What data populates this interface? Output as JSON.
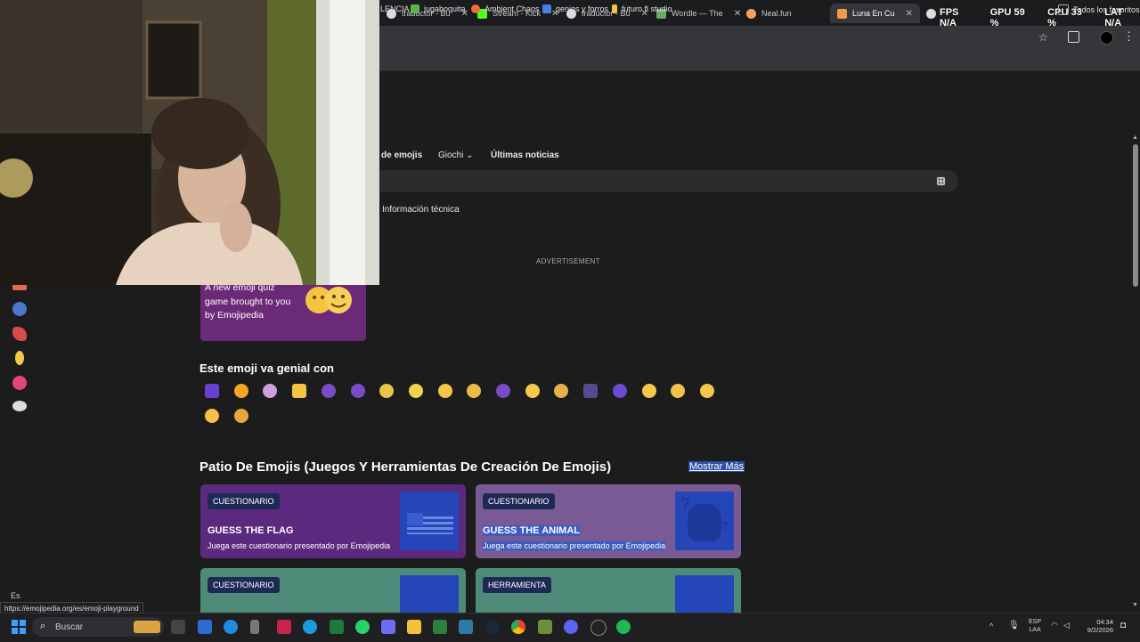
{
  "tabs": [
    {
      "label": "traductor - Bu",
      "color": "#4285f4"
    },
    {
      "label": "Stream - Kick",
      "color": "#53fc18"
    },
    {
      "label": "traductor - Bu",
      "color": "#4285f4"
    },
    {
      "label": "Wordle — The",
      "color": "#6aaa64"
    },
    {
      "label": "Neal.fun",
      "color": "#f4a261"
    },
    {
      "label": "Luna En Cu",
      "color": "#f2994a",
      "active": true
    },
    {
      "label": "",
      "color": "#4285f4"
    }
  ],
  "overlay": {
    "fps": "FPS N/A",
    "gpu": "GPU 59 %",
    "cpu": "CPU 33 %",
    "lat": "LAT N/A"
  },
  "bookmarks": [
    {
      "label": "LENCIA",
      "color": ""
    },
    {
      "label": "jugaboquita",
      "color": "#57b846"
    },
    {
      "label": "Ambient Chaos",
      "color": "#f06a3a"
    },
    {
      "label": "genios y forros",
      "color": "#4a7ee6"
    },
    {
      "label": "futuro fl studio",
      "color": "#f4c542"
    },
    {
      "label": "Todos los favoritos",
      "color": "#aaaaaa"
    }
  ],
  "nav": {
    "emojis": "de emojis",
    "games": "Giochi",
    "news": "Últimas noticias"
  },
  "tech_info": "Información técnica",
  "advertisement": "ADVERTISEMENT",
  "promo": {
    "text": "A new emoji quiz game brought to you by Emojipedia"
  },
  "goes_with": {
    "title": "Este emoji va genial con",
    "emojis": [
      "moon-circle",
      "smiling-face-hearts",
      "person-moon",
      "star",
      "new-moon",
      "waxing-crescent",
      "first-quarter",
      "waxing-gibbous",
      "full-moon",
      "waning-gibbous",
      "last-quarter",
      "crescent",
      "moon-face",
      "night-sky",
      "eyes-moon",
      "crescent-face",
      "first-quarter-face",
      "sun-face",
      "smiling-face",
      "ringed-planet"
    ]
  },
  "playground": {
    "title": "Patio De Emojis (Juegos Y Herramientas De Creación De Emojis)",
    "show_more": "Mostrar Más",
    "cards": [
      {
        "badge": "CUESTIONARIO",
        "title": "GUESS THE FLAG",
        "desc": "Juega este cuestionario presentado por Emojipedia"
      },
      {
        "badge": "CUESTIONARIO",
        "title": "GUESS THE ANIMAL",
        "desc": "Juega este cuestionario presentado por Emojipedia"
      },
      {
        "badge": "CUESTIONARIO",
        "title": "",
        "desc": ""
      },
      {
        "badge": "HERRAMIENTA",
        "title": "",
        "desc": ""
      }
    ]
  },
  "status_url": "https://emojipedia.org/es/emoji-playground",
  "taskbar": {
    "search_placeholder": "Buscar",
    "lang": "ESP",
    "lang2": "LAA",
    "time": "04:34",
    "date": "9/2/2026"
  },
  "keyboard_lang": "Es"
}
